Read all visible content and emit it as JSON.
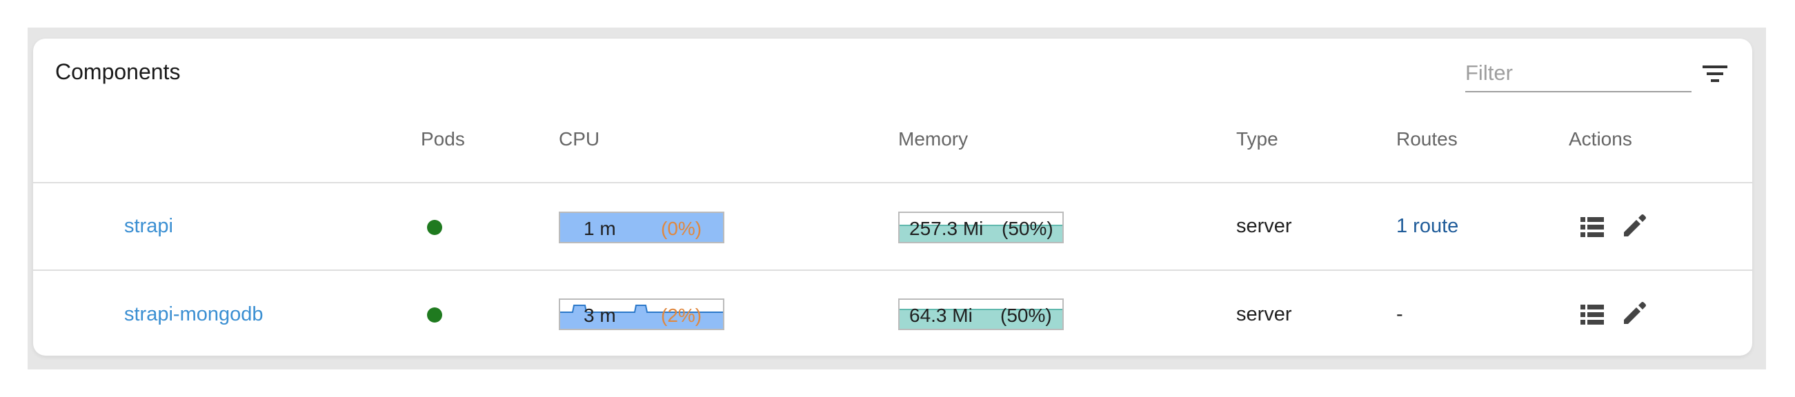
{
  "panel": {
    "title": "Components",
    "filter_placeholder": "Filter",
    "filter_icon": "filter-list-icon"
  },
  "columns": {
    "pods": "Pods",
    "cpu": "CPU",
    "memory": "Memory",
    "type": "Type",
    "routes": "Routes",
    "actions": "Actions"
  },
  "rows": [
    {
      "name": "strapi",
      "pod_status_color": "#1f7a1f",
      "cpu_value": "1 m",
      "cpu_percent": "(0%)",
      "memory_value": "257.3 Mi",
      "memory_percent": "(50%)",
      "type": "server",
      "routes": "1 route",
      "actions": [
        "list-icon",
        "pencil-icon"
      ]
    },
    {
      "name": "strapi-mongodb",
      "pod_status_color": "#1f7a1f",
      "cpu_value": "3 m",
      "cpu_percent": "(2%)",
      "memory_value": "64.3 Mi",
      "memory_percent": "(50%)",
      "type": "server",
      "routes": "-",
      "actions": [
        "list-icon",
        "pencil-icon"
      ]
    }
  ],
  "colors": {
    "cpu_fill": "#90bdf7",
    "cpu_line": "#2b78c9",
    "memory_fill": "#9fd9d2",
    "pod_running": "#1f7a1f",
    "link": "#3b8fd2"
  }
}
